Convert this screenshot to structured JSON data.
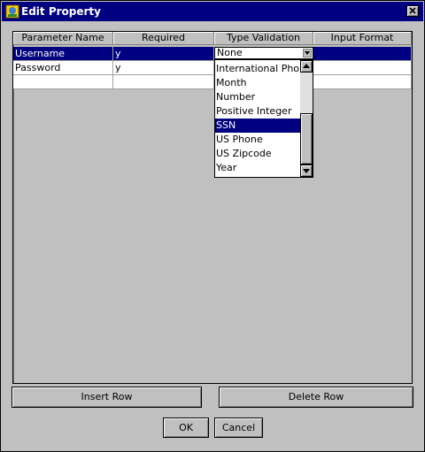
{
  "window": {
    "title": "Edit Property"
  },
  "table": {
    "columns": [
      "Parameter Name",
      "Required",
      "Type Validation",
      "Input Format"
    ],
    "rows": [
      {
        "name": "Username",
        "required": "y",
        "type": "None",
        "format": ""
      },
      {
        "name": "Password",
        "required": "y",
        "type": "",
        "format": ""
      },
      {
        "name": "",
        "required": "",
        "type": "",
        "format": ""
      }
    ]
  },
  "dropdown": {
    "current": "None",
    "items": [
      "International Phone",
      "Month",
      "Number",
      "Positive Integer",
      "SSN",
      "US Phone",
      "US Zipcode",
      "Year"
    ],
    "selected": "SSN"
  },
  "buttons": {
    "insert_row": "Insert Row",
    "delete_row": "Delete Row",
    "ok": "OK",
    "cancel": "Cancel"
  }
}
